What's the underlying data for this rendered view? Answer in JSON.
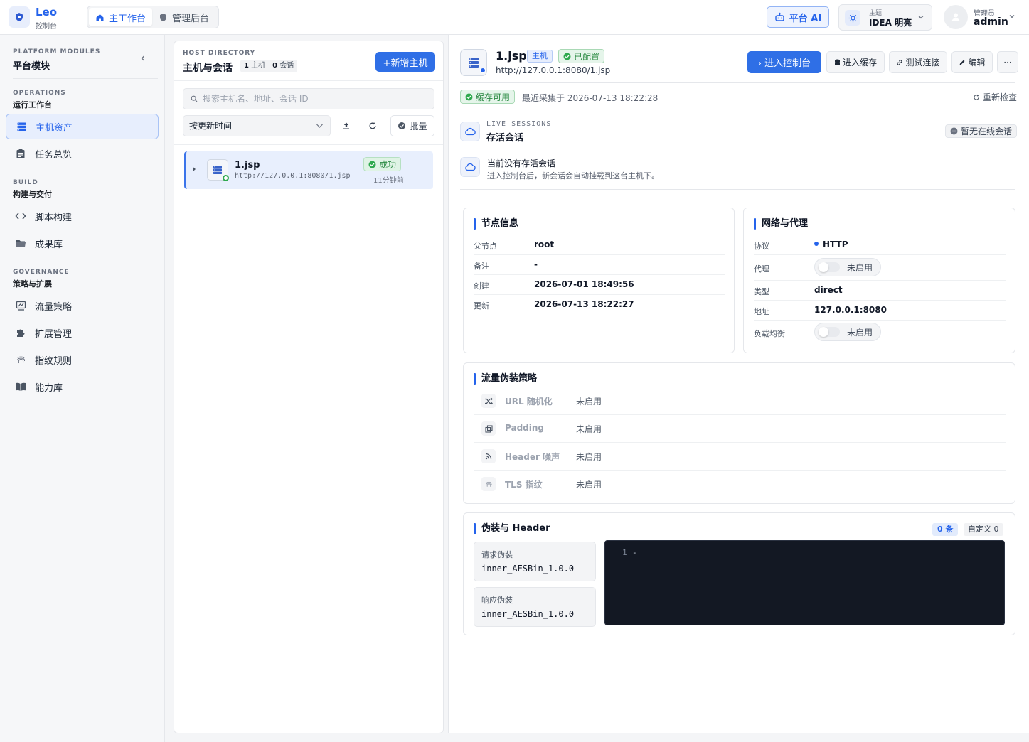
{
  "app": {
    "name": "Leo",
    "subtitle": "控制台"
  },
  "top_nav": {
    "tabs": [
      {
        "label": "主工作台",
        "active": true
      },
      {
        "label": "管理后台",
        "active": false
      }
    ]
  },
  "header": {
    "ai_label": "平台 AI",
    "theme_caption": "主题",
    "theme_value": "IDEA 明亮",
    "user_role": "管理员",
    "user_name": "admin"
  },
  "sidebar": {
    "title_en": "PLATFORM MODULES",
    "title_cn": "平台模块",
    "groups": [
      {
        "en": "OPERATIONS",
        "cn": "运行工作台",
        "items": [
          {
            "label": "主机资产",
            "icon": "server-icon",
            "active": true
          },
          {
            "label": "任务总览",
            "icon": "clipboard-icon"
          }
        ]
      },
      {
        "en": "BUILD",
        "cn": "构建与交付",
        "items": [
          {
            "label": "脚本构建",
            "icon": "code-icon"
          },
          {
            "label": "成果库",
            "icon": "folder-icon"
          }
        ]
      },
      {
        "en": "GOVERNANCE",
        "cn": "策略与扩展",
        "items": [
          {
            "label": "流量策略",
            "icon": "traffic-icon"
          },
          {
            "label": "扩展管理",
            "icon": "puzzle-icon"
          },
          {
            "label": "指纹规则",
            "icon": "fingerprint-icon"
          },
          {
            "label": "能力库",
            "icon": "book-icon"
          }
        ]
      }
    ]
  },
  "host_directory": {
    "title_en": "HOST DIRECTORY",
    "title_cn": "主机与会话",
    "host_count": "1",
    "host_unit": "主机",
    "session_count": "0",
    "session_unit": "会话",
    "add_button": "+新增主机",
    "search_placeholder": "搜索主机名、地址、会话 ID",
    "sort_label": "按更新时间",
    "batch_label": "批量",
    "hosts": [
      {
        "name": "1.jsp",
        "url": "http://127.0.0.1:8080/1.jsp",
        "status": "成功",
        "time": "11分钟前"
      }
    ]
  },
  "detail": {
    "name": "1.jsp",
    "tag_host": "主机",
    "tag_configured": "已配置",
    "url": "http://127.0.0.1:8080/1.jsp",
    "actions": {
      "console": "› 进入控制台",
      "cache": "进入缓存",
      "test": "测试连接",
      "edit": "编辑",
      "more": "···"
    },
    "cache_status": "缓存可用",
    "cache_time": "最近采集于 2026-07-13 18:22:28",
    "recheck": "重新检查",
    "live_sessions": {
      "title_en": "LIVE SESSIONS",
      "title_cn": "存活会话",
      "badge": "暂无在线会话",
      "empty_title": "当前没有存活会话",
      "empty_sub": "进入控制台后，新会话会自动挂载到这台主机下。"
    },
    "node_info": {
      "title": "节点信息",
      "rows": [
        {
          "k": "父节点",
          "v": "root"
        },
        {
          "k": "备注",
          "v": "-"
        },
        {
          "k": "创建",
          "v": "2026-07-01 18:49:56"
        },
        {
          "k": "更新",
          "v": "2026-07-13 18:22:27"
        }
      ]
    },
    "network": {
      "title": "网络与代理",
      "protocol_label": "协议",
      "protocol": "HTTP",
      "proxy_label": "代理",
      "proxy": "未启用",
      "type_label": "类型",
      "type": "direct",
      "address_label": "地址",
      "address": "127.0.0.1:8080",
      "lb_label": "负载均衡",
      "lb": "未启用"
    },
    "traffic": {
      "title": "流量伪装策略",
      "rows": [
        {
          "name": "URL 随机化",
          "value": "未启用",
          "icon": "shuffle-icon"
        },
        {
          "name": "Padding",
          "value": "未启用",
          "icon": "padding-icon"
        },
        {
          "name": "Header 噪声",
          "value": "未启用",
          "icon": "rss-icon"
        },
        {
          "name": "TLS 指纹",
          "value": "未启用",
          "icon": "fingerprint-icon"
        }
      ]
    },
    "header_disguise": {
      "title": "伪装与 Header",
      "count": "0 条",
      "custom": "自定义 0",
      "request_label": "请求伪装",
      "request_value": "inner_AESBin_1.0.0",
      "response_label": "响应伪装",
      "response_value": "inner_AESBin_1.0.0",
      "code_line_no": "1",
      "code_text": "-"
    }
  }
}
